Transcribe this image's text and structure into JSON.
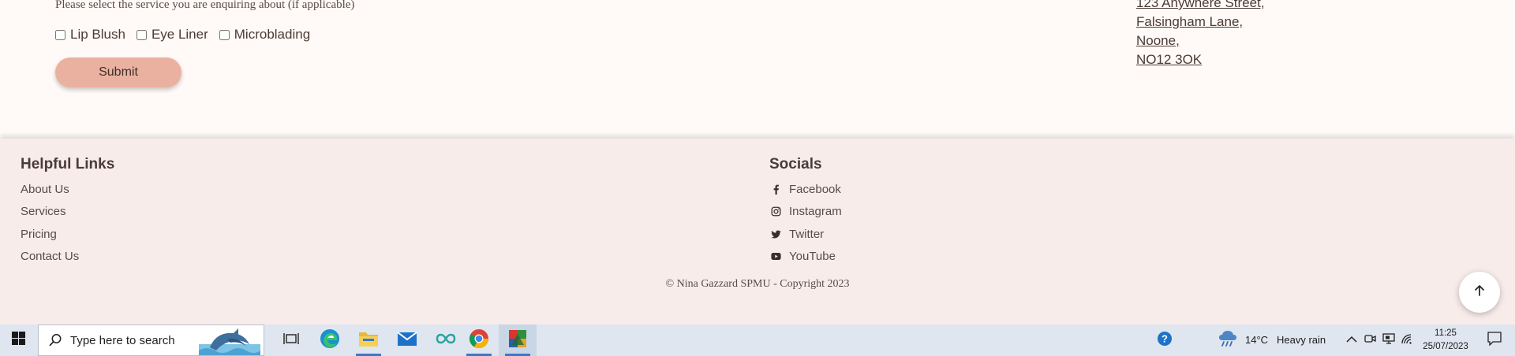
{
  "form": {
    "service_hint": "Please select the service you are enquiring about (if applicable)",
    "services": [
      "Lip Blush",
      "Eye Liner",
      "Microblading"
    ],
    "submit_label": "Submit"
  },
  "address": {
    "lines": [
      "123 Anywhere Street,",
      "Falsingham Lane,",
      "Noone,",
      "NO12 3OK"
    ]
  },
  "footer": {
    "helpful_title": "Helpful Links",
    "helpful_links": [
      "About Us",
      "Services",
      "Pricing",
      "Contact Us"
    ],
    "socials_title": "Socials",
    "socials": [
      {
        "label": "Facebook",
        "icon": "facebook-icon"
      },
      {
        "label": "Instagram",
        "icon": "instagram-icon"
      },
      {
        "label": "Twitter",
        "icon": "twitter-icon"
      },
      {
        "label": "YouTube",
        "icon": "youtube-icon"
      }
    ],
    "copyright": "© Nina Gazzard SPMU - Copyright 2023"
  },
  "taskbar": {
    "search_placeholder": "Type here to search",
    "weather_temp": "14°C",
    "weather_desc": "Heavy rain",
    "time": "11:25",
    "date": "25/07/2023"
  },
  "colors": {
    "page_bg": "#fffaf7",
    "footer_bg": "#f8ecea",
    "accent": "#eab1a0",
    "text": "#4a3b36",
    "taskbar_bg": "#dfe6ef"
  }
}
